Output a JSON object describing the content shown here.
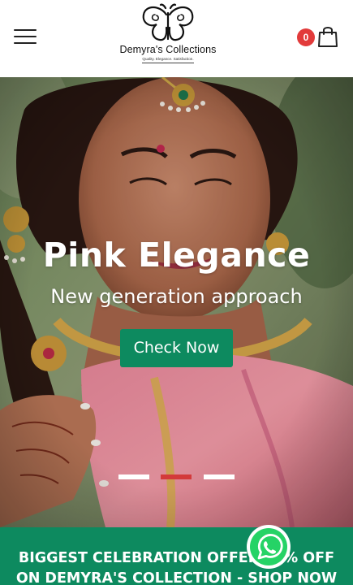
{
  "header": {
    "brand_name": "Demyra's Collections",
    "brand_tagline": "Quality. Elegance. Satisfaction.",
    "cart_count": "0"
  },
  "hero": {
    "title": "Pink Elegance",
    "subtitle": "New generation approach",
    "cta_label": "Check Now",
    "slides_total": 3,
    "active_slide": 2
  },
  "offer": {
    "text": "BIGGEST CELEBRATION OFFER 30% OFF ON DEMYRA'S COLLECTION - SHOP NOW"
  },
  "colors": {
    "accent_green": "#0d8a5f",
    "badge_red": "#e23b3b",
    "dot_active": "#d33a3a"
  },
  "icons": [
    "hamburger-menu-icon",
    "shopping-bag-icon",
    "whatsapp-icon",
    "butterfly-logo-icon"
  ]
}
